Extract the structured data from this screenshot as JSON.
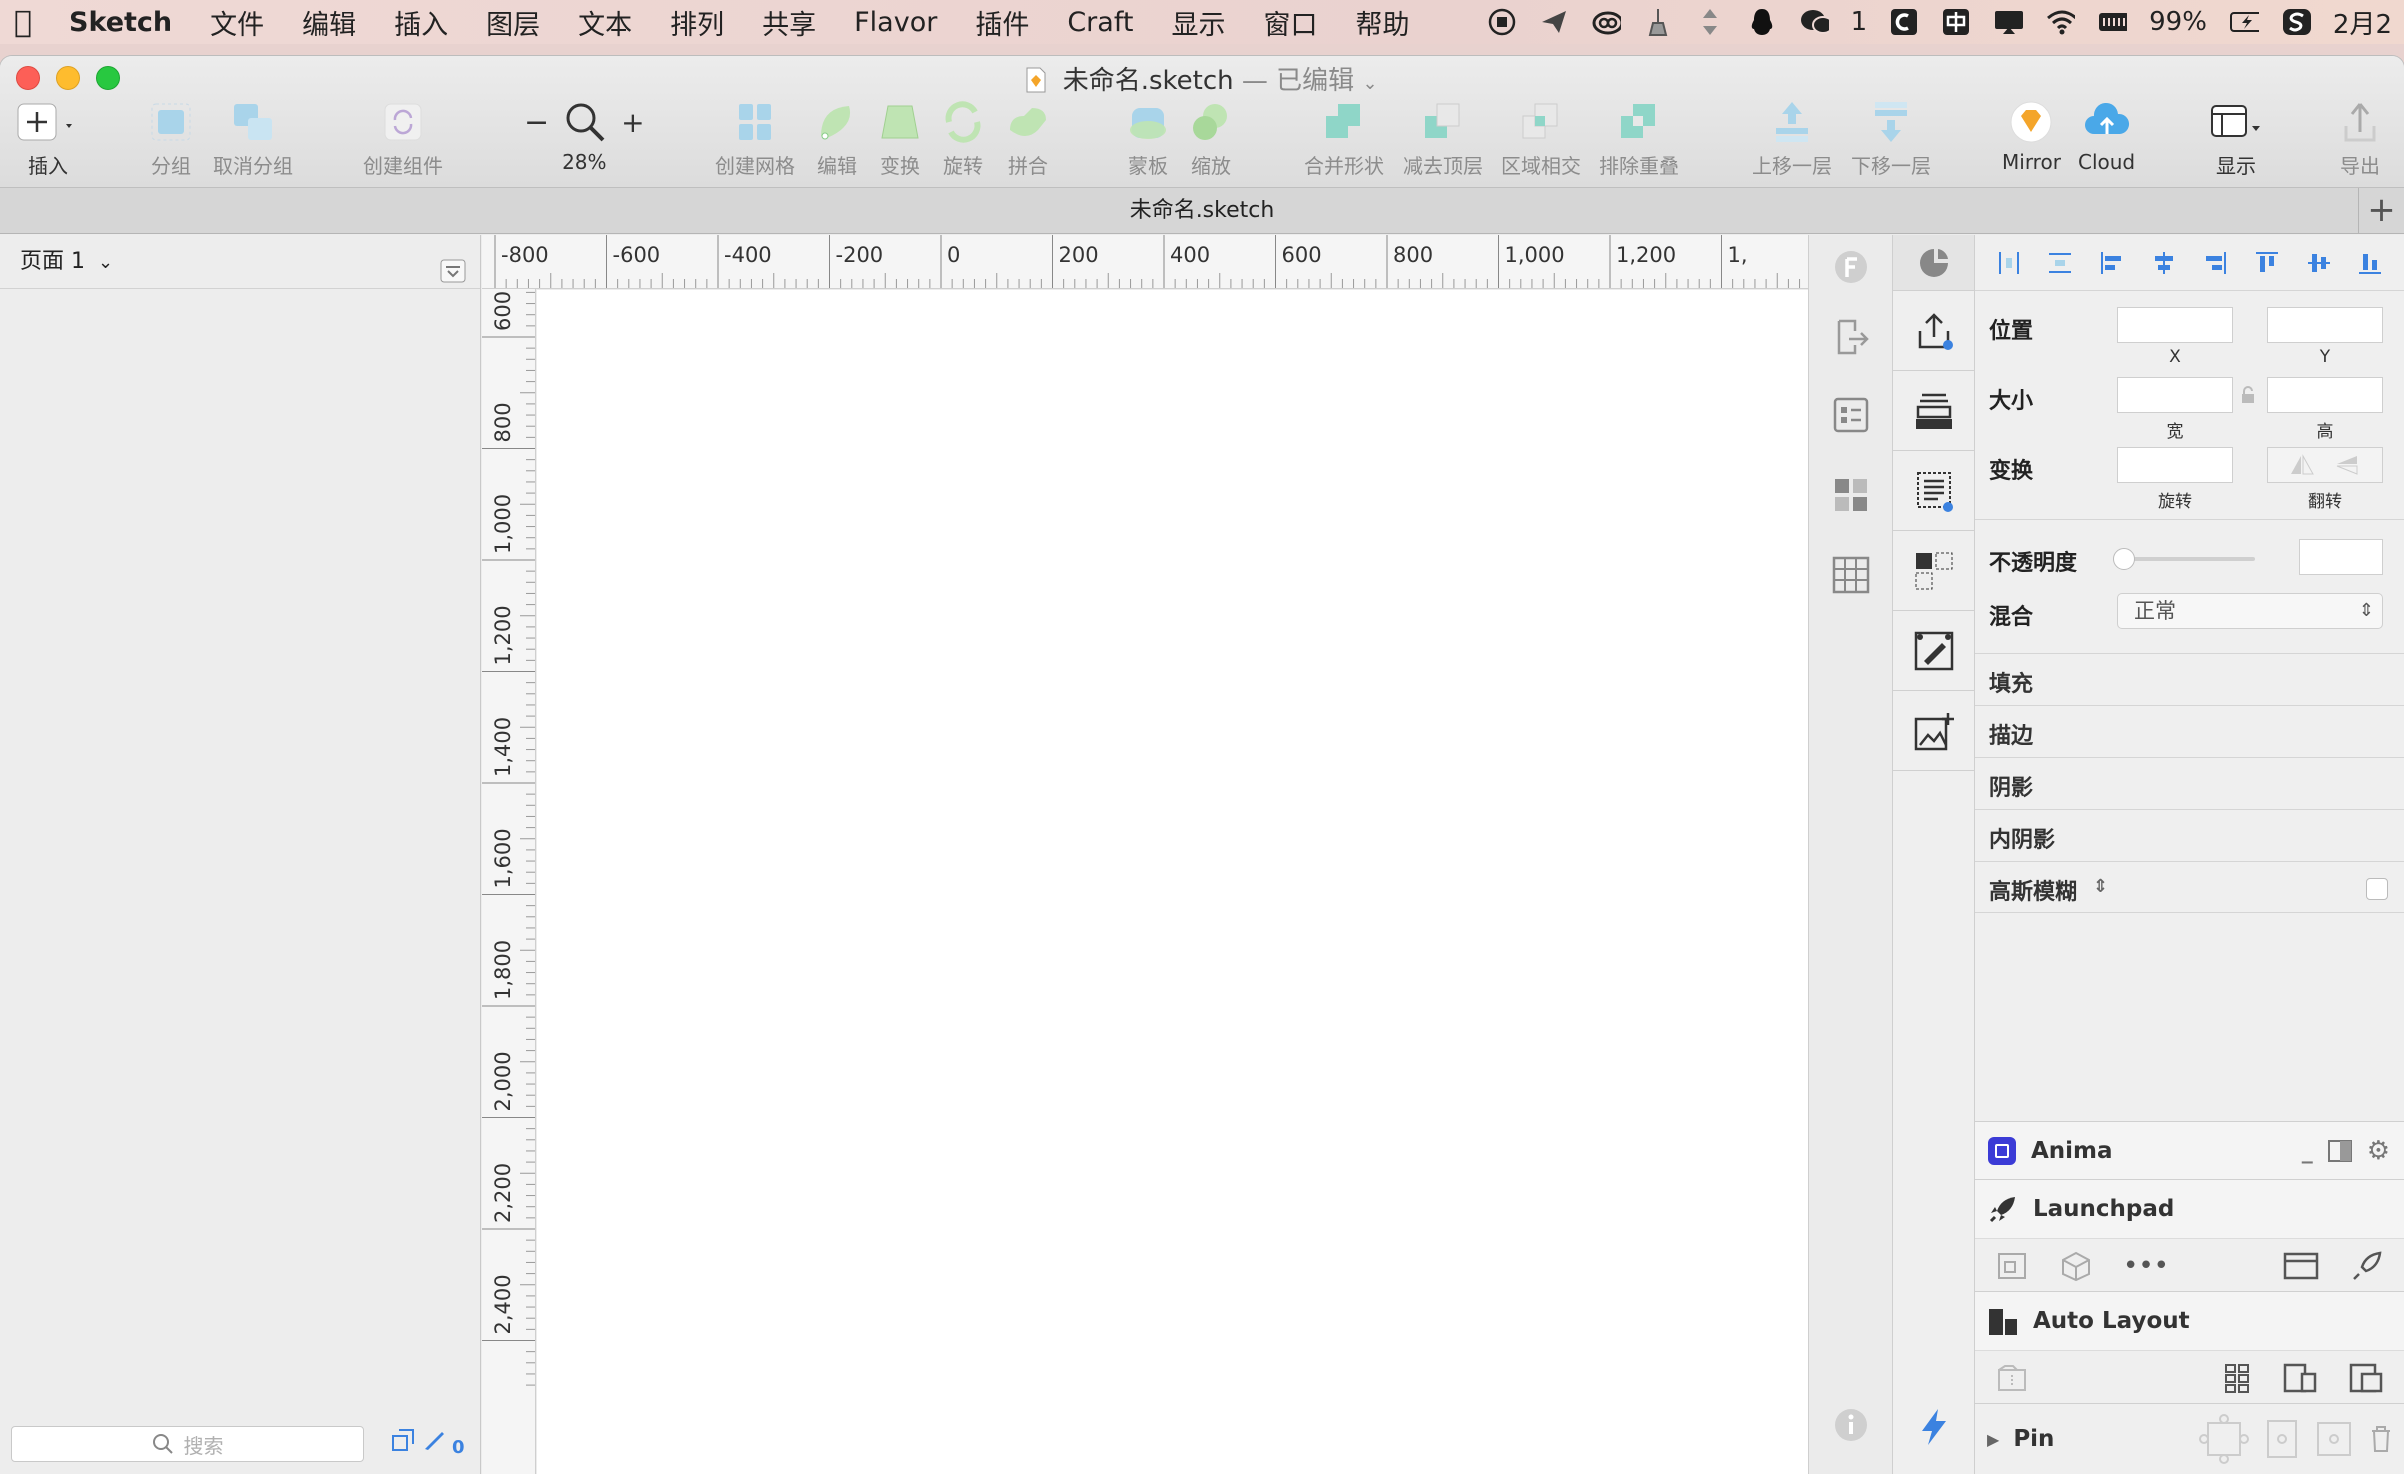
{
  "menubar": {
    "app": "Sketch",
    "items": [
      "文件",
      "编辑",
      "插入",
      "图层",
      "文本",
      "排列",
      "共享",
      "Flavor",
      "插件",
      "Craft",
      "显示",
      "窗口",
      "帮助"
    ],
    "wechat_count": "1",
    "battery": "99%",
    "date": "2月2"
  },
  "window": {
    "title": "未命名.sketch",
    "title_suffix": "— 已编辑",
    "tab": "未命名.sketch"
  },
  "toolbar": {
    "insert": "插入",
    "group": "分组",
    "ungroup": "取消分组",
    "create_symbol": "创建组件",
    "zoom": "28%",
    "create_grid": "创建网格",
    "edit": "编辑",
    "transform": "变换",
    "rotate": "旋转",
    "combine": "拼合",
    "mask": "蒙板",
    "scale": "缩放",
    "union": "合并形状",
    "subtract": "减去顶层",
    "intersect": "区域相交",
    "difference": "排除重叠",
    "forward": "上移一层",
    "backward": "下移一层",
    "mirror": "Mirror",
    "cloud": "Cloud",
    "view": "显示",
    "export": "导出"
  },
  "left_panel": {
    "page": "页面 1",
    "search_placeholder": "搜索",
    "slice_count": "0"
  },
  "rulers": {
    "top": [
      "-800",
      "-600",
      "-400",
      "-200",
      "0",
      "200",
      "400",
      "600",
      "800",
      "1,000",
      "1,200",
      "1,"
    ],
    "left": [
      "600",
      "800",
      "1,000",
      "1,200",
      "1,400",
      "1,600",
      "1,800",
      "2,000",
      "2,200",
      "2,400"
    ]
  },
  "inspector": {
    "position": "位置",
    "x": "X",
    "y": "Y",
    "size": "大小",
    "width": "宽",
    "height": "高",
    "transform": "变换",
    "rotate": "旋转",
    "flip": "翻转",
    "opacity": "不透明度",
    "blend": "混合",
    "blend_value": "正常",
    "fill": "填充",
    "border": "描边",
    "shadow": "阴影",
    "inner_shadow": "内阴影",
    "blur": "高斯模糊"
  },
  "plugins": {
    "anima": "Anima",
    "launchpad": "Launchpad",
    "auto_layout": "Auto Layout",
    "pin": "Pin"
  },
  "colors": {
    "accent": "#3b82e0",
    "anima": "#3b3bd6",
    "mirror": "#f4a52a"
  }
}
